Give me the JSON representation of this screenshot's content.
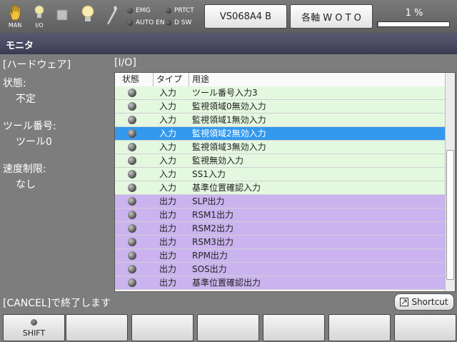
{
  "toolbar": {
    "icons": [
      {
        "name": "hand-icon",
        "label": "MAN"
      },
      {
        "name": "bulb-icon",
        "label": "I/O"
      },
      {
        "name": "stop-square-icon",
        "label": ""
      },
      {
        "name": "lightbulb-icon",
        "label": ""
      },
      {
        "name": "wrench-icon",
        "label": ""
      }
    ],
    "indicators": [
      "EMG",
      "PRTCT",
      "AUTO EN",
      "D SW"
    ],
    "program_button": "VS068A4 B",
    "axis_button": "各軸 W O T O",
    "progress_label": "1 %",
    "progress_value": 0.01
  },
  "title": "モニタ",
  "hardware": {
    "heading": "[ハードウェア]",
    "state_label": "状態:",
    "state_value": "不定",
    "tool_label": "ツール番号:",
    "tool_value": "ツール0",
    "speed_label": "速度制限:",
    "speed_value": "なし"
  },
  "io": {
    "heading": "[I/O]",
    "headers": [
      "状態",
      "タイプ",
      "用途"
    ],
    "rows": [
      {
        "type": "入力",
        "use": "ツール番号入力3",
        "kind": "in",
        "selected": false
      },
      {
        "type": "入力",
        "use": "監視領域0無効入力",
        "kind": "in",
        "selected": false
      },
      {
        "type": "入力",
        "use": "監視領域1無効入力",
        "kind": "in",
        "selected": false
      },
      {
        "type": "入力",
        "use": "監視領域2無効入力",
        "kind": "in",
        "selected": true
      },
      {
        "type": "入力",
        "use": "監視領域3無効入力",
        "kind": "in",
        "selected": false
      },
      {
        "type": "入力",
        "use": "監視無効入力",
        "kind": "in",
        "selected": false
      },
      {
        "type": "入力",
        "use": "SS1入力",
        "kind": "in",
        "selected": false
      },
      {
        "type": "入力",
        "use": "基準位置確認入力",
        "kind": "in",
        "selected": false
      },
      {
        "type": "出力",
        "use": "SLP出力",
        "kind": "out",
        "selected": false
      },
      {
        "type": "出力",
        "use": "RSM1出力",
        "kind": "out",
        "selected": false
      },
      {
        "type": "出力",
        "use": "RSM2出力",
        "kind": "out",
        "selected": false
      },
      {
        "type": "出力",
        "use": "RSM3出力",
        "kind": "out",
        "selected": false
      },
      {
        "type": "出力",
        "use": "RPM出力",
        "kind": "out",
        "selected": false
      },
      {
        "type": "出力",
        "use": "SOS出力",
        "kind": "out",
        "selected": false
      },
      {
        "type": "出力",
        "use": "基準位置確認出力",
        "kind": "out",
        "selected": false
      }
    ]
  },
  "status_message": "[CANCEL]で終了します",
  "shortcut_label": "Shortcut",
  "function_keys": [
    "SHIFT",
    "",
    "",
    "",
    "",
    "",
    ""
  ],
  "colors": {
    "input_row": "#e4f8e0",
    "output_row": "#cbb3ef",
    "selected_row": "#3399ee"
  }
}
